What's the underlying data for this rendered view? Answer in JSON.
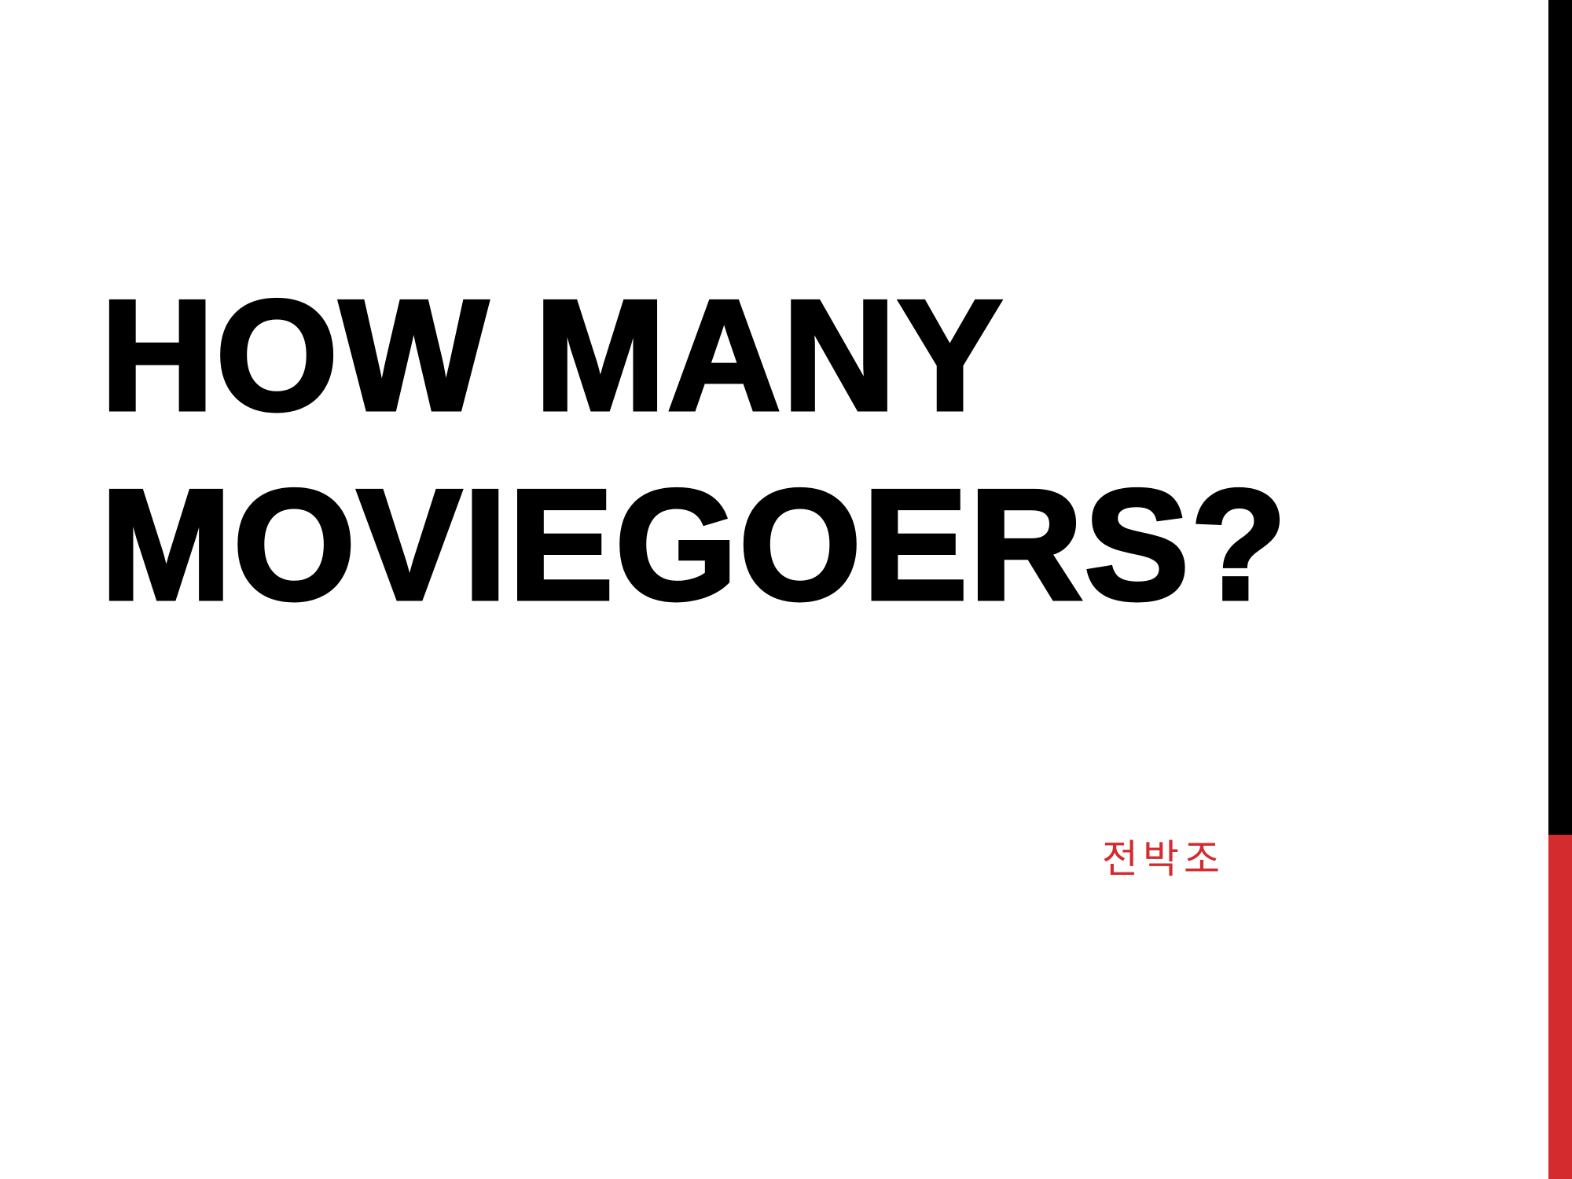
{
  "slide": {
    "title_lines": [
      "HOW MANY",
      "MOVIEGOERS?"
    ],
    "subtitle": "전박조"
  },
  "colors": {
    "accent": "#d42b2f",
    "bar": "#000000",
    "text": "#000000",
    "background": "#ffffff"
  }
}
